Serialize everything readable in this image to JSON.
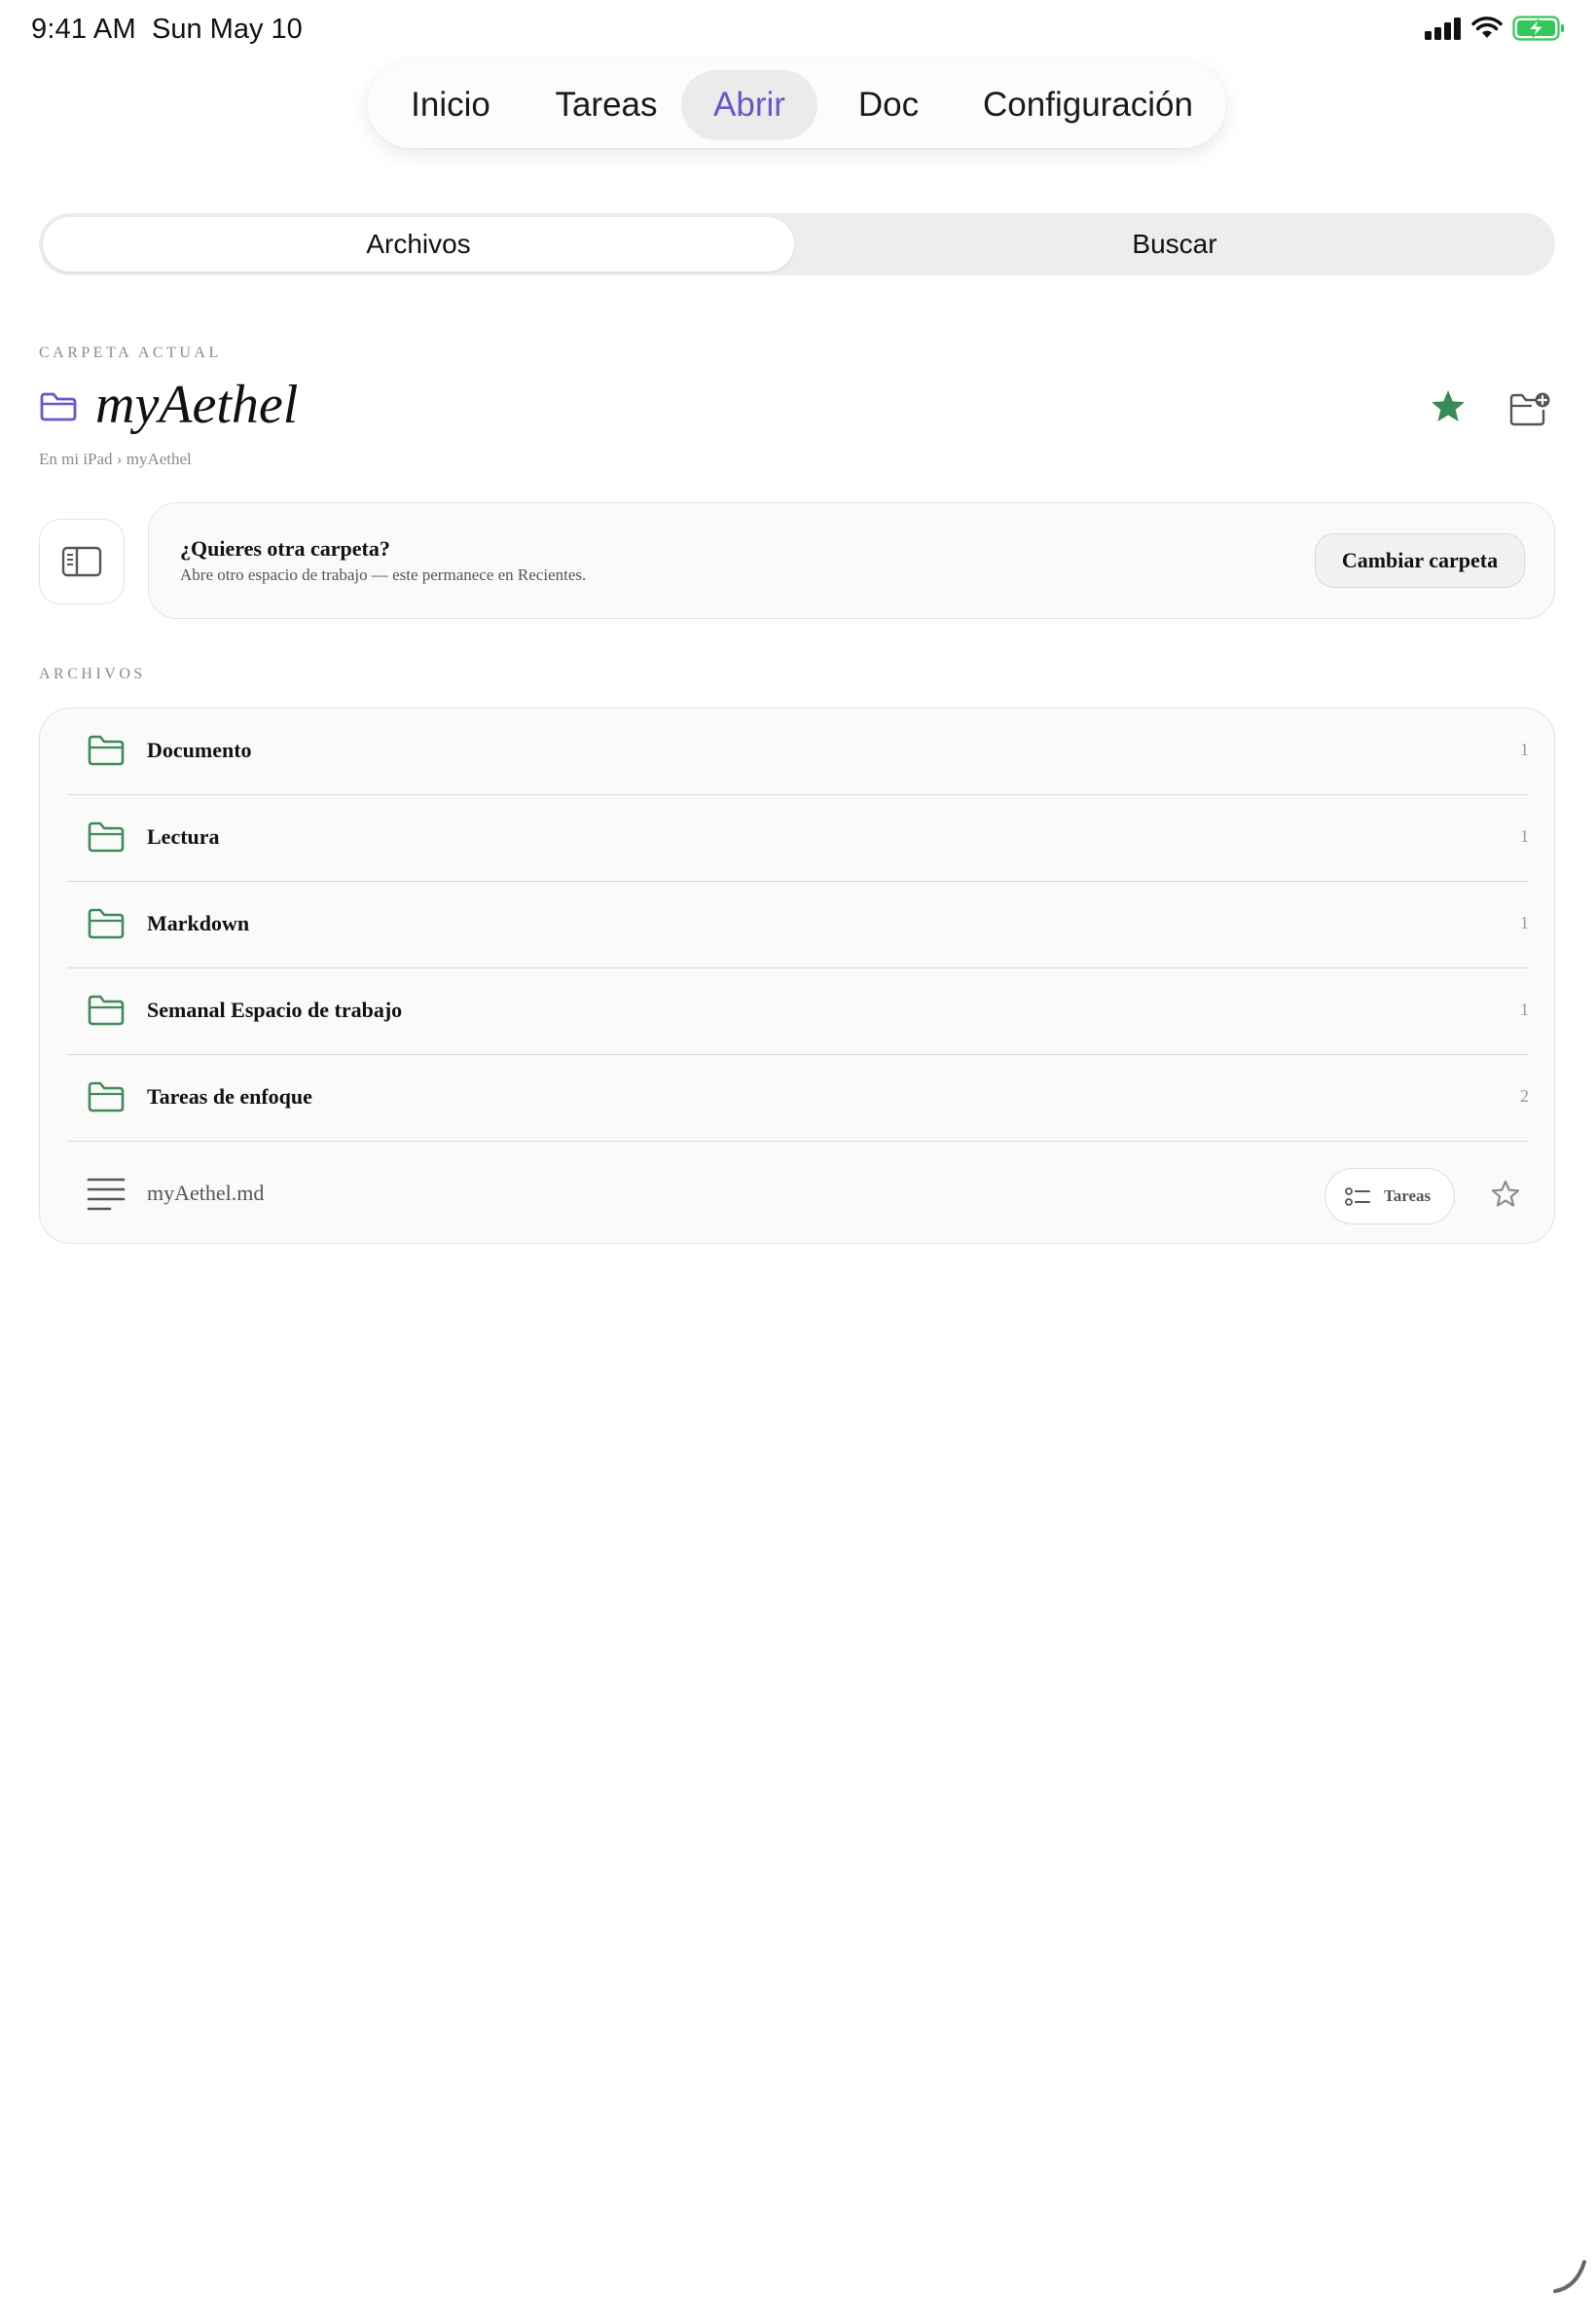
{
  "status_bar": {
    "time": "9:41 AM",
    "date": "Sun May 10"
  },
  "top_tabs": [
    {
      "label": "Inicio",
      "active": false
    },
    {
      "label": "Tareas",
      "active": false
    },
    {
      "label": "Abrir",
      "active": true
    },
    {
      "label": "Doc",
      "active": false
    },
    {
      "label": "Configuración",
      "active": false
    }
  ],
  "segmented": {
    "files_label": "Archivos",
    "search_label": "Buscar",
    "selected": "Archivos"
  },
  "current_folder": {
    "section_label": "CARPETA ACTUAL",
    "name": "myAethel",
    "breadcrumb": "En mi iPad › myAethel",
    "favorited": true
  },
  "prompt": {
    "title": "¿Quieres otra carpeta?",
    "subtitle": "Abre otro espacio de trabajo — este permanece en Recientes.",
    "button_label": "Cambiar carpeta"
  },
  "files_section": {
    "label": "ARCHIVOS",
    "folders": [
      {
        "name": "Documento",
        "count": "1"
      },
      {
        "name": "Lectura",
        "count": "1"
      },
      {
        "name": "Markdown",
        "count": "1"
      },
      {
        "name": "Semanal Espacio de trabajo",
        "count": "1"
      },
      {
        "name": "Tareas de enfoque",
        "count": "2"
      }
    ],
    "file": {
      "name": "myAethel.md",
      "chip_label": "Tareas",
      "favorited": false
    }
  },
  "colors": {
    "accent": "#6a55c9",
    "folder_green": "#3f8a58",
    "star_green": "#3a8a57",
    "battery_green": "#34c759"
  },
  "icons": {
    "folder": "folder-icon",
    "star": "star-icon",
    "new_folder": "folder-plus-icon",
    "sidebar": "sidebar-icon",
    "document": "text-lines-icon",
    "tasks": "checklist-icon"
  }
}
